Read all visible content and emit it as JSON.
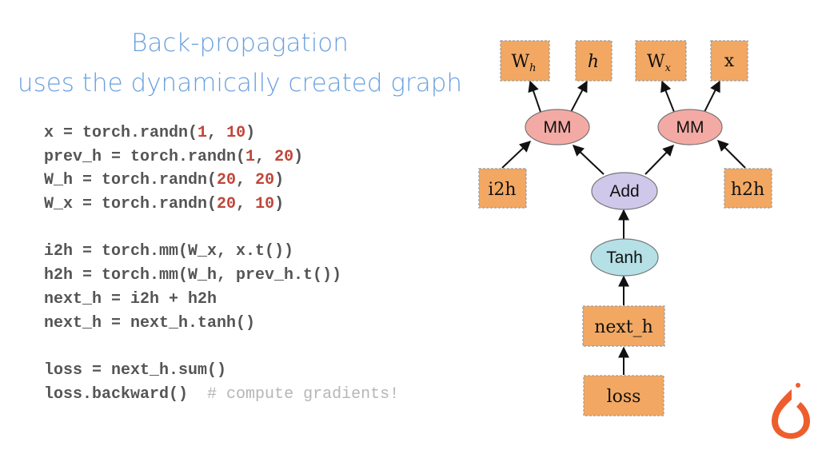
{
  "title": {
    "line1": "Back-propagation",
    "line2": "uses the dynamically created graph"
  },
  "code": [
    {
      "parts": [
        {
          "t": "x = torch.randn("
        },
        {
          "t": "1",
          "c": "num"
        },
        {
          "t": ", "
        },
        {
          "t": "10",
          "c": "num"
        },
        {
          "t": ")"
        }
      ]
    },
    {
      "parts": [
        {
          "t": "prev_h = torch.randn("
        },
        {
          "t": "1",
          "c": "num"
        },
        {
          "t": ", "
        },
        {
          "t": "20",
          "c": "num"
        },
        {
          "t": ")"
        }
      ]
    },
    {
      "parts": [
        {
          "t": "W_h = torch.randn("
        },
        {
          "t": "20",
          "c": "num"
        },
        {
          "t": ", "
        },
        {
          "t": "20",
          "c": "num"
        },
        {
          "t": ")"
        }
      ]
    },
    {
      "parts": [
        {
          "t": "W_x = torch.randn("
        },
        {
          "t": "20",
          "c": "num"
        },
        {
          "t": ", "
        },
        {
          "t": "10",
          "c": "num"
        },
        {
          "t": ")"
        }
      ]
    },
    {
      "gap": true
    },
    {
      "parts": [
        {
          "t": "i2h = torch.mm(W_x, x.t())"
        }
      ]
    },
    {
      "parts": [
        {
          "t": "h2h = torch.mm(W_h, prev_h.t())"
        }
      ]
    },
    {
      "parts": [
        {
          "t": "next_h = i2h + h2h"
        }
      ]
    },
    {
      "parts": [
        {
          "t": "next_h = next_h.tanh()"
        }
      ]
    },
    {
      "gap": true
    },
    {
      "parts": [
        {
          "t": "loss = next_h.sum()"
        }
      ]
    },
    {
      "parts": [
        {
          "t": "loss.backward()  "
        },
        {
          "t": "# compute gradients!",
          "c": "comment"
        }
      ]
    }
  ],
  "graph": {
    "nodes": {
      "W_h": {
        "label": "W",
        "sub": "h"
      },
      "h": {
        "label": "h"
      },
      "W_x": {
        "label": "W",
        "sub": "x"
      },
      "x": {
        "label": "x"
      },
      "mm_left": {
        "label": "MM"
      },
      "mm_right": {
        "label": "MM"
      },
      "i2h": {
        "label": "i2h"
      },
      "add": {
        "label": "Add"
      },
      "h2h": {
        "label": "h2h"
      },
      "tanh": {
        "label": "Tanh"
      },
      "next_h": {
        "label": "next_h"
      },
      "loss": {
        "label": "loss"
      }
    },
    "colors": {
      "variable": "#f2a863",
      "mm": "#f4aaa4",
      "add": "#cfc8ea",
      "tanh": "#b4e0e6",
      "logo": "#ee5e2d"
    }
  },
  "logo": {
    "icon": "pytorch-flame-icon"
  }
}
